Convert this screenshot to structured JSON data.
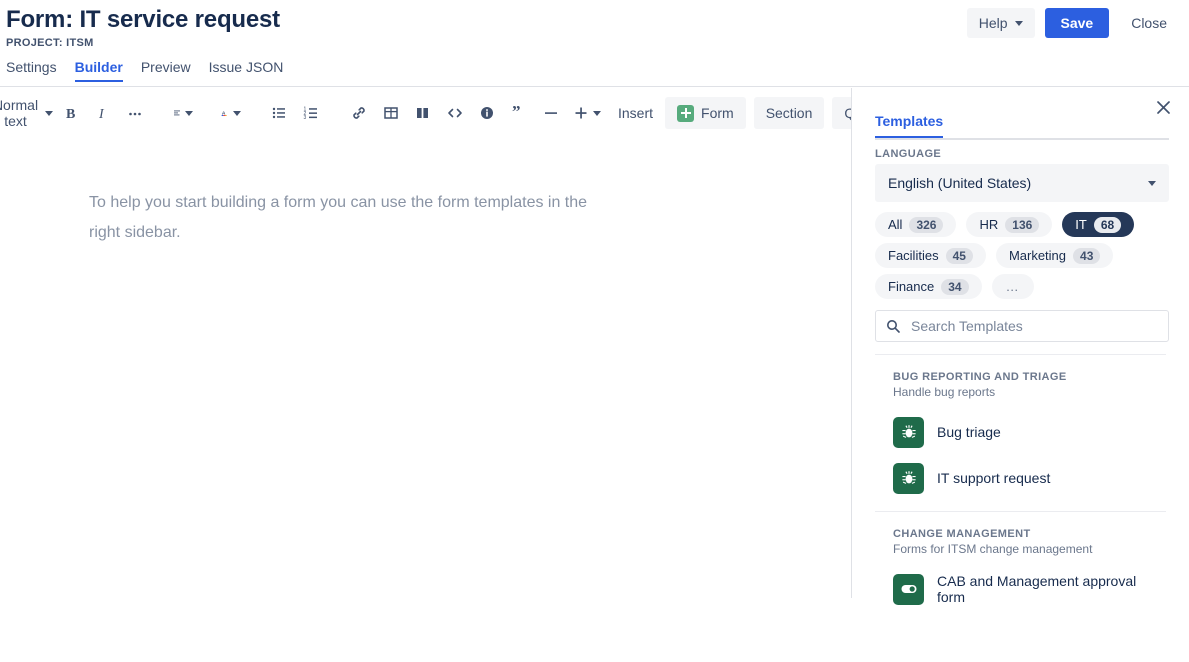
{
  "header": {
    "title": "Form: IT service request",
    "project": "PROJECT: ITSM",
    "help_label": "Help",
    "save_label": "Save",
    "close_label": "Close"
  },
  "tabs": [
    {
      "label": "Settings",
      "active": false
    },
    {
      "label": "Builder",
      "active": true
    },
    {
      "label": "Preview",
      "active": false
    },
    {
      "label": "Issue JSON",
      "active": false
    }
  ],
  "toolbar": {
    "text_style": "Normal text",
    "bold": "B",
    "italic": "I",
    "more_formatting": "…",
    "insert_label": "Insert",
    "form_label": "Form",
    "section_label": "Section",
    "question_label": "Question"
  },
  "editor": {
    "placeholder": "To help you start building a form you can use the form templates in the right sidebar."
  },
  "sidebar": {
    "tab_label": "Templates",
    "language_label": "LANGUAGE",
    "language_value": "English (United States)",
    "search_placeholder": "Search Templates",
    "chips": [
      {
        "label": "All",
        "count": "326",
        "selected": false
      },
      {
        "label": "HR",
        "count": "136",
        "selected": false
      },
      {
        "label": "IT",
        "count": "68",
        "selected": true
      },
      {
        "label": "Facilities",
        "count": "45",
        "selected": false
      },
      {
        "label": "Marketing",
        "count": "43",
        "selected": false
      },
      {
        "label": "Finance",
        "count": "34",
        "selected": false
      },
      {
        "label": "…",
        "count": "",
        "selected": false
      }
    ],
    "groups": [
      {
        "title": "BUG REPORTING AND TRIAGE",
        "subtitle": "Handle bug reports",
        "items": [
          {
            "name": "Bug triage",
            "icon": "bug-icon"
          },
          {
            "name": "IT support request",
            "icon": "bug-icon"
          }
        ]
      },
      {
        "title": "CHANGE MANAGEMENT",
        "subtitle": "Forms for ITSM change management",
        "items": [
          {
            "name": "CAB and Management approval form",
            "icon": "toggle-icon"
          }
        ]
      }
    ]
  },
  "colors": {
    "primary_blue": "#2C5FE0",
    "chip_selected": "#253858",
    "template_icon_green": "#1F6B4A",
    "form_plus_green": "#57AB7D",
    "text_dark": "#172B4D",
    "text_muted": "#6B778C"
  }
}
